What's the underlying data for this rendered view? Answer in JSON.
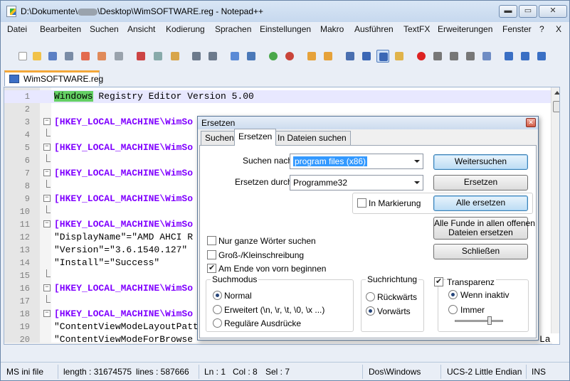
{
  "window": {
    "title_prefix": "D:\\Dokumente\\",
    "title_suffix": "\\Desktop\\WimSOFTWARE.reg - Notepad++",
    "minimize": "▬",
    "maximize": "▭",
    "close": "✕"
  },
  "menu": [
    "Datei",
    "Bearbeiten",
    "Suchen",
    "Ansicht",
    "Kodierung",
    "Sprachen",
    "Einstellungen",
    "Makro",
    "Ausführen",
    "TextFX",
    "Erweiterungen",
    "Fenster",
    "?",
    "X"
  ],
  "tab": {
    "label": "WimSOFTWARE.reg"
  },
  "editor": {
    "lines": [
      {
        "n": "1",
        "text": "Windows Registry Editor Version 5.00"
      },
      {
        "n": "2",
        "text": ""
      },
      {
        "n": "3",
        "text": "[HKEY_LOCAL_MACHINE\\WimSo"
      },
      {
        "n": "4",
        "text": ""
      },
      {
        "n": "5",
        "text": "[HKEY_LOCAL_MACHINE\\WimSo"
      },
      {
        "n": "6",
        "text": ""
      },
      {
        "n": "7",
        "text": "[HKEY_LOCAL_MACHINE\\WimSo"
      },
      {
        "n": "8",
        "text": ""
      },
      {
        "n": "9",
        "text": "[HKEY_LOCAL_MACHINE\\WimSo"
      },
      {
        "n": "10",
        "text": ""
      },
      {
        "n": "11",
        "text": "[HKEY_LOCAL_MACHINE\\WimSo"
      },
      {
        "n": "12",
        "text": "\"DisplayName\"=\"AMD AHCI R"
      },
      {
        "n": "13",
        "text": "\"Version\"=\"3.6.1540.127\""
      },
      {
        "n": "14",
        "text": "\"Install\"=\"Success\""
      },
      {
        "n": "15",
        "text": ""
      },
      {
        "n": "16",
        "text": "[HKEY_LOCAL_MACHINE\\WimSo"
      },
      {
        "n": "17",
        "text": ""
      },
      {
        "n": "18",
        "text": "[HKEY_LOCAL_MACHINE\\WimSo"
      },
      {
        "n": "19",
        "text": "\"ContentViewModeLayoutPatt"
      },
      {
        "n": "20",
        "text": "\"ContentViewModeForBrowse"
      }
    ],
    "line1_highlight": "Windows",
    "line1_rest": " Registry Editor Version 5.00",
    "right_fragment": "La"
  },
  "dialog": {
    "title": "Ersetzen",
    "close": "✕",
    "tabs": [
      "Suchen",
      "Ersetzen",
      "In Dateien suchen"
    ],
    "search_label": "Suchen nach",
    "search_value": "program files (x86)",
    "replace_label": "Ersetzen durch",
    "replace_value": "Programme32",
    "in_selection": "In Markierung",
    "buttons": {
      "find_next": "Weitersuchen",
      "replace": "Ersetzen",
      "replace_all": "Alle ersetzen",
      "replace_all_open_1": "Alle Funde in allen offenen",
      "replace_all_open_2": "Dateien ersetzen",
      "close": "Schließen"
    },
    "options": {
      "whole_word": "Nur ganze Wörter suchen",
      "match_case": "Groß-/Kleinschreibung",
      "wrap": "Am Ende von vorn beginnen"
    },
    "search_mode": {
      "title": "Suchmodus",
      "normal": "Normal",
      "extended": "Erweitert (\\n, \\r, \\t, \\0, \\x ...)",
      "regex": "Reguläre Ausdrücke"
    },
    "direction": {
      "title": "Suchrichtung",
      "up": "Rückwärts",
      "down": "Vorwärts"
    },
    "transparency": {
      "title": "Transparenz",
      "inactive": "Wenn inaktiv",
      "always": "Immer"
    }
  },
  "status": {
    "type": "MS ini file",
    "length": "length : 31674575",
    "lines": "lines : 587666",
    "ln": "Ln : 1",
    "col": "Col : 8",
    "sel": "Sel : 7",
    "eol": "Dos\\Windows",
    "encoding": "UCS-2 Little Endian",
    "mode": "INS"
  }
}
